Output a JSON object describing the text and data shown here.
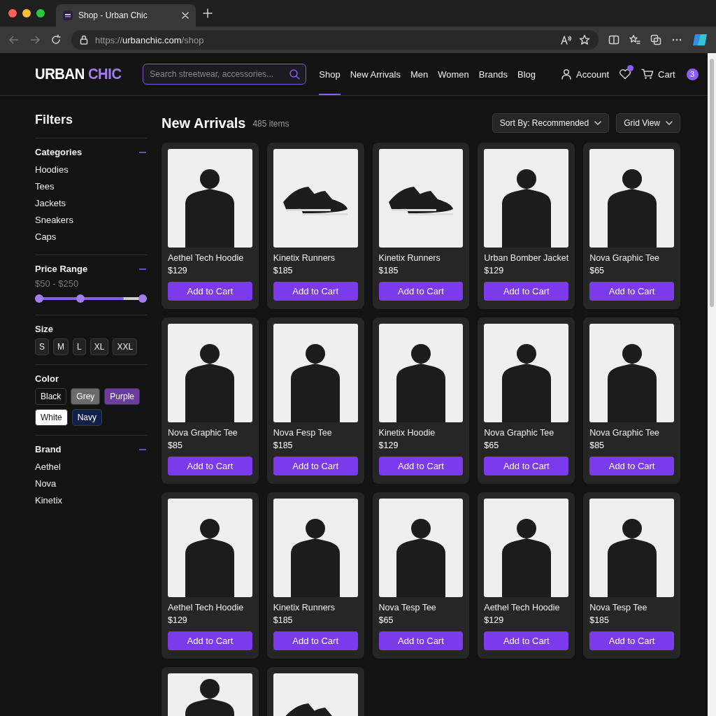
{
  "browser": {
    "tab_title": "Shop - Urban Chic",
    "url_scheme": "https://",
    "url_host": "urbanchic.com",
    "url_path": "/shop"
  },
  "header": {
    "logo_first": "URBAN",
    "logo_second": "CHIC",
    "search": {
      "placeholder": "Search streetwear, accessories..."
    },
    "nav": [
      {
        "label": "Shop",
        "selected": true
      },
      {
        "label": "New Arrivals",
        "selected": false
      },
      {
        "label": "Men",
        "selected": false
      },
      {
        "label": "Women",
        "selected": false
      },
      {
        "label": "Brands",
        "selected": false
      },
      {
        "label": "Blog",
        "selected": false
      }
    ],
    "account": "Account",
    "cart": "Cart",
    "cart_count": "3"
  },
  "filters": {
    "title": "Filters",
    "sections": [
      {
        "kind": "list",
        "title": "Categories",
        "expanded": true,
        "items": [
          "Hoodies",
          "Tees",
          "Jackets",
          "Sneakers",
          "Caps"
        ]
      },
      {
        "kind": "range",
        "title": "Price Range",
        "expanded": true,
        "reading": "$50 - $250",
        "level": 0.82,
        "thumbs": [
          {
            "level": 0
          },
          {
            "level": 0.4
          },
          {
            "level": 1
          }
        ]
      },
      {
        "kind": "chips",
        "title": "Size",
        "items": [
          "S",
          "M",
          "L",
          "XL",
          "XXL"
        ]
      },
      {
        "kind": "colors",
        "title": "Color",
        "items": [
          {
            "label": "Black",
            "color": "#141414"
          },
          {
            "label": "Grey",
            "color": "#6b6b6b"
          },
          {
            "label": "Purple",
            "color": "#6b3d9e"
          },
          {
            "label": "White",
            "color": "#ffffff"
          },
          {
            "label": "Navy",
            "color": "#13204a"
          }
        ]
      },
      {
        "kind": "list",
        "title": "Brand",
        "expanded": true,
        "items": [
          "Aethel",
          "Nova",
          "Kinetix"
        ]
      }
    ]
  },
  "listing": {
    "title": "New Arrivals",
    "count": "485 items",
    "sort": "Sort By: Recommended",
    "view": "Grid View"
  },
  "products": [
    {
      "kind": "person",
      "cut_off": false,
      "name": "Aethel Tech Hoodie",
      "price": "$129",
      "button": "Add to Cart"
    },
    {
      "kind": "shoes",
      "cut_off": false,
      "name": "Kinetix Runners",
      "price": "$185",
      "button": "Add to Cart"
    },
    {
      "kind": "shoes",
      "cut_off": false,
      "name": "Kinetix Runners",
      "price": "$185",
      "button": "Add to Cart"
    },
    {
      "kind": "person",
      "cut_off": false,
      "name": "Urban Bomber Jacket",
      "price": "$129",
      "button": "Add to Cart"
    },
    {
      "kind": "person",
      "cut_off": false,
      "name": "Nova Graphic Tee",
      "price": "$65",
      "button": "Add to Cart"
    },
    {
      "kind": "person",
      "cut_off": false,
      "name": "Nova Graphic Tee",
      "price": "$85",
      "button": "Add to Cart"
    },
    {
      "kind": "person",
      "cut_off": false,
      "name": "Nova Fesp Tee",
      "price": "$185",
      "button": "Add to Cart"
    },
    {
      "kind": "person",
      "cut_off": false,
      "name": "Kinetix Hoodie",
      "price": "$129",
      "button": "Add to Cart"
    },
    {
      "kind": "person",
      "cut_off": false,
      "name": "Nova Graphic Tee",
      "price": "$65",
      "button": "Add to Cart"
    },
    {
      "kind": "person",
      "cut_off": false,
      "name": "Nova Graphic Tee",
      "price": "$85",
      "button": "Add to Cart"
    },
    {
      "kind": "person",
      "cut_off": false,
      "name": "Aethel Tech Hoodie",
      "price": "$129",
      "button": "Add to Cart"
    },
    {
      "kind": "person",
      "cut_off": false,
      "name": "Kinetix Runners",
      "price": "$185",
      "button": "Add to Cart"
    },
    {
      "kind": "person",
      "cut_off": false,
      "name": "Nova Tesp Tee",
      "price": "$65",
      "button": "Add to Cart"
    },
    {
      "kind": "person",
      "cut_off": false,
      "name": "Aethel Tech Hoodie",
      "price": "$129",
      "button": "Add to Cart"
    },
    {
      "kind": "person",
      "cut_off": false,
      "name": "Nova Tesp Tee",
      "price": "$185",
      "button": "Add to Cart"
    },
    {
      "kind": "person",
      "cut_off": true
    },
    {
      "kind": "shoes",
      "cut_off": true
    }
  ]
}
